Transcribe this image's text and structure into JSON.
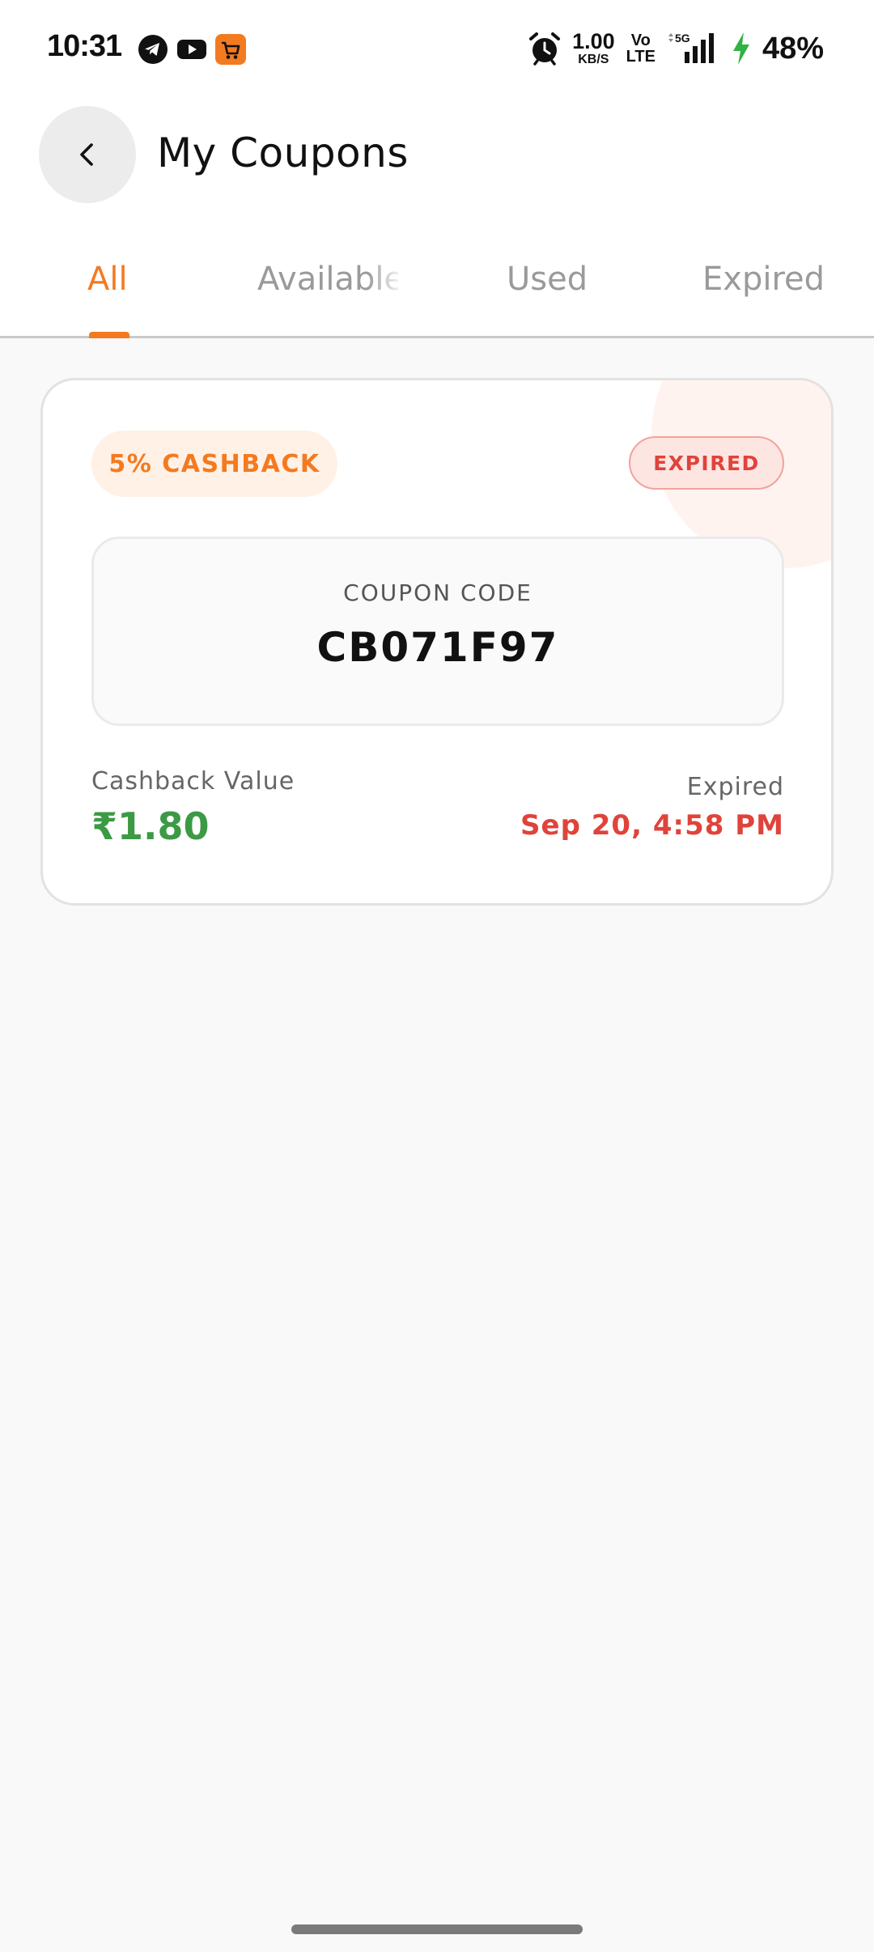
{
  "status_bar": {
    "time": "10:31",
    "net_speed": "1.00",
    "net_speed_unit": "KB/S",
    "volte_top": "Vo",
    "volte_bottom": "LTE",
    "network_type": "5G",
    "battery": "48%",
    "app_icons": [
      "telegram-icon",
      "youtube-icon",
      "shopping-cart-icon"
    ]
  },
  "header": {
    "back_icon": "chevron-left-icon",
    "title": "My Coupons"
  },
  "tabs": {
    "selected": "All",
    "items": [
      {
        "label": "All"
      },
      {
        "label": "Available"
      },
      {
        "label": "Used"
      },
      {
        "label": "Expired"
      }
    ]
  },
  "coupons": [
    {
      "offer": "5% CASHBACK",
      "status": "EXPIRED",
      "code_label": "COUPON CODE",
      "code": "CB071F97",
      "value_label": "Cashback Value",
      "value": "₹1.80",
      "expiry_label": "Expired",
      "expiry_date": "Sep 20, 4:58 PM"
    }
  ],
  "colors": {
    "accent": "#f47a20",
    "status_expired": "#e0433a",
    "value_green": "#3c9a45",
    "background": "#f9f9f9"
  }
}
